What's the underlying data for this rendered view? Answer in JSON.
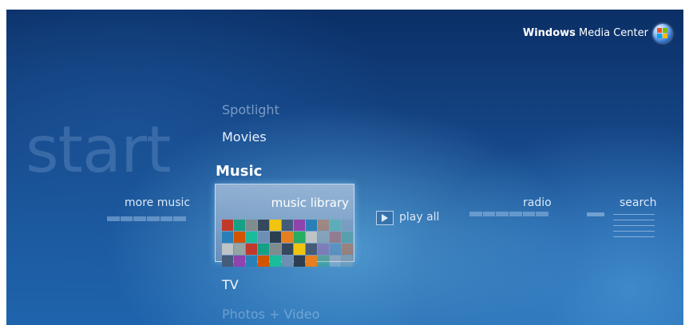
{
  "brand": {
    "bold": "Windows",
    "rest": " Media Center",
    "logo": "windows-orb-icon"
  },
  "start_word": "start",
  "menu": {
    "spotlight": "Spotlight",
    "movies": "Movies",
    "music": "Music",
    "tv": "TV",
    "photos": "Photos + Video"
  },
  "strip": {
    "more_music": "more music",
    "music_library": "music library",
    "play_all": "play all",
    "radio": "radio",
    "search": "search"
  },
  "colors": {
    "background_top": "#0b2f66",
    "background_bottom": "#1e64ad",
    "focus_tile": "#9fb6d2"
  }
}
